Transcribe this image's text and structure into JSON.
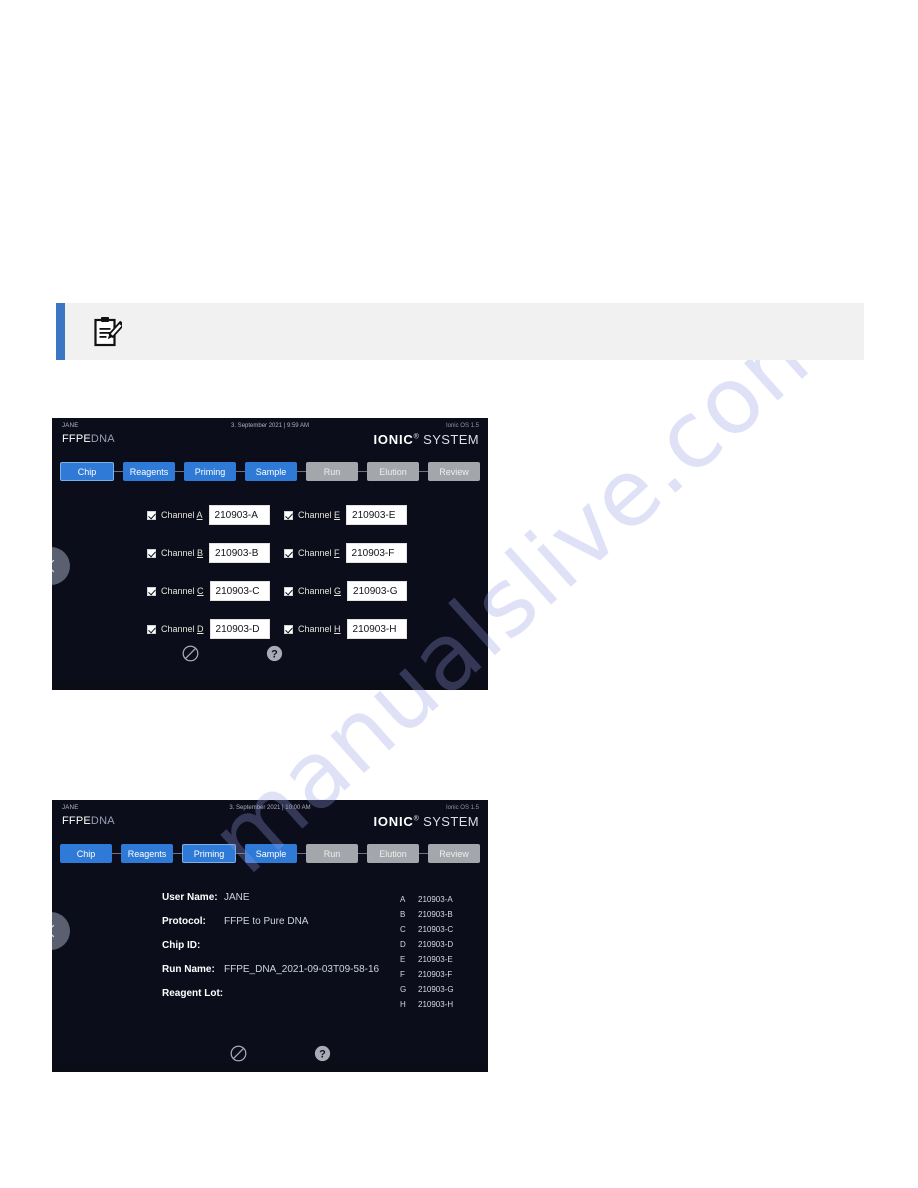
{
  "note": {
    "icon": "clipboard-pencil-icon",
    "text": "",
    "accent_color": "#3a76c4",
    "background": "#f1f1f1"
  },
  "watermark": {
    "text": "manualslive.com",
    "color": "#969be1"
  },
  "screenshot_sample": {
    "header": {
      "user": "JANE",
      "datetime": "3. September 2021 | 9:59 AM",
      "version": "Ionic OS 1.5",
      "protocol_primary": "FFPE",
      "protocol_secondary": "DNA",
      "brand_strong": "IONIC",
      "brand_reg": "®",
      "brand_rest": " SYSTEM"
    },
    "tabs": [
      {
        "label": "Chip",
        "state": "current"
      },
      {
        "label": "Reagents",
        "state": "active"
      },
      {
        "label": "Priming",
        "state": "active"
      },
      {
        "label": "Sample",
        "state": "active"
      },
      {
        "label": "Run",
        "state": "inactive"
      },
      {
        "label": "Elution",
        "state": "inactive"
      },
      {
        "label": "Review",
        "state": "inactive"
      }
    ],
    "channels": [
      {
        "label_prefix": "Channel ",
        "label_key": "A",
        "value": "210903-A",
        "checked": true
      },
      {
        "label_prefix": "Channel ",
        "label_key": "E",
        "value": "210903-E",
        "checked": true
      },
      {
        "label_prefix": "Channel ",
        "label_key": "B",
        "value": "210903-B",
        "checked": true
      },
      {
        "label_prefix": "Channel ",
        "label_key": "F",
        "value": "210903-F",
        "checked": true
      },
      {
        "label_prefix": "Channel ",
        "label_key": "C",
        "value": "210903-C",
        "checked": true
      },
      {
        "label_prefix": "Channel ",
        "label_key": "G",
        "value": "210903-G",
        "checked": true
      },
      {
        "label_prefix": "Channel ",
        "label_key": "D",
        "value": "210903-D",
        "checked": true
      },
      {
        "label_prefix": "Channel ",
        "label_key": "H",
        "value": "210903-H",
        "checked": true
      }
    ],
    "footer_icons": [
      {
        "name": "cancel-icon",
        "glyph": "no-entry"
      },
      {
        "name": "help-icon",
        "glyph": "question"
      }
    ],
    "nav": {
      "prev": "previous-step",
      "next": "next-step"
    }
  },
  "screenshot_summary": {
    "header": {
      "user": "JANE",
      "datetime": "3. September 2021 | 10:00 AM",
      "version": "Ionic OS 1.5",
      "protocol_primary": "FFPE",
      "protocol_secondary": "DNA",
      "brand_strong": "IONIC",
      "brand_reg": "®",
      "brand_rest": " SYSTEM"
    },
    "tabs": [
      {
        "label": "Chip",
        "state": "active"
      },
      {
        "label": "Reagents",
        "state": "active"
      },
      {
        "label": "Priming",
        "state": "current"
      },
      {
        "label": "Sample",
        "state": "active"
      },
      {
        "label": "Run",
        "state": "inactive"
      },
      {
        "label": "Elution",
        "state": "inactive"
      },
      {
        "label": "Review",
        "state": "inactive"
      }
    ],
    "fields": [
      {
        "label": "User Name:",
        "value": "JANE"
      },
      {
        "label": "Protocol:",
        "value": "FFPE to Pure DNA"
      },
      {
        "label": "Chip ID:",
        "value": ""
      },
      {
        "label": "Run Name:",
        "value": "FFPE_DNA_2021-09-03T09-58-16"
      },
      {
        "label": "Reagent Lot:",
        "value": ""
      }
    ],
    "channel_list": [
      {
        "letter": "A",
        "value": "210903-A"
      },
      {
        "letter": "B",
        "value": "210903-B"
      },
      {
        "letter": "C",
        "value": "210903-C"
      },
      {
        "letter": "D",
        "value": "210903-D"
      },
      {
        "letter": "E",
        "value": "210903-E"
      },
      {
        "letter": "F",
        "value": "210903-F"
      },
      {
        "letter": "G",
        "value": "210903-G"
      },
      {
        "letter": "H",
        "value": "210903-H"
      }
    ],
    "footer_icons": [
      {
        "name": "cancel-icon",
        "glyph": "no-entry"
      },
      {
        "name": "help-icon",
        "glyph": "question"
      }
    ],
    "nav": {
      "prev": "previous-step",
      "next": "next-step"
    }
  }
}
